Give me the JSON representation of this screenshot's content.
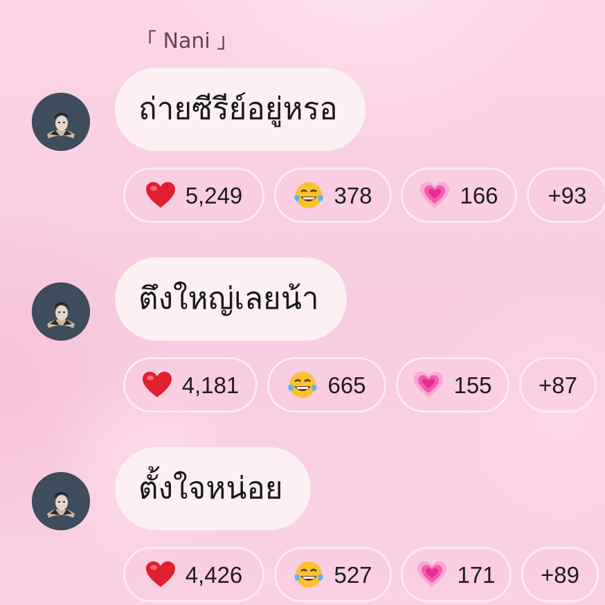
{
  "thread": {
    "sender_name": "Nani",
    "bracket_open": "「",
    "bracket_close": "」"
  },
  "messages": [
    {
      "text": "ถ่ายซีรีย์อยู่หรอ",
      "reactions": [
        {
          "icon": "red-heart-icon",
          "count": "5,249"
        },
        {
          "icon": "tears-of-joy-icon",
          "count": "378"
        },
        {
          "icon": "growing-heart-icon",
          "count": "166"
        }
      ],
      "more": "+93"
    },
    {
      "text": "ตึงใหญ่เลยน้า",
      "reactions": [
        {
          "icon": "red-heart-icon",
          "count": "4,181"
        },
        {
          "icon": "tears-of-joy-icon",
          "count": "665"
        },
        {
          "icon": "growing-heart-icon",
          "count": "155"
        }
      ],
      "more": "+87"
    },
    {
      "text": "ตั้งใจหน่อย",
      "reactions": [
        {
          "icon": "red-heart-icon",
          "count": "4,426"
        },
        {
          "icon": "tears-of-joy-icon",
          "count": "527"
        },
        {
          "icon": "growing-heart-icon",
          "count": "171"
        }
      ],
      "more": "+89"
    }
  ],
  "colors": {
    "background": "#fbd3e5",
    "bubble": "#fdf0f3",
    "chip_border": "#fdebf2",
    "sender_text": "#6e3d5b",
    "avatar_bg": "#3e4c5e",
    "heart_red": "#e0202e",
    "heart_pink": "#f25bb0"
  }
}
